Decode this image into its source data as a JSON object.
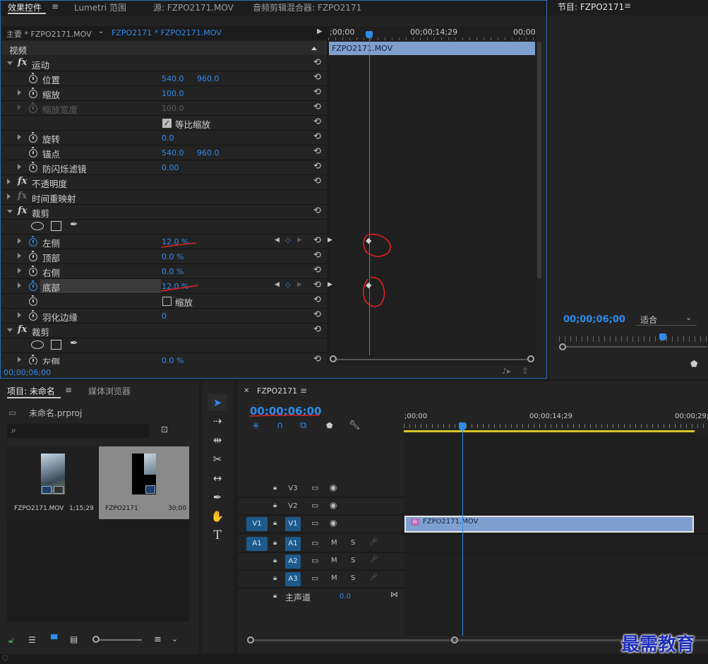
{
  "effect_controls": {
    "tabs": [
      "效果控件",
      "Lumetri 范围",
      "源: FZPO2171.MOV",
      "音频剪辑混合器: FZPO2171"
    ],
    "master_label": "主要 * FZPO2171.MOV",
    "sequence_clip_label": "FZPO2171 * FZPO2171.MOV",
    "section_video": "视频",
    "timeline_start": ";00;00",
    "timeline_mid": "00;00;14;29",
    "timeline_end": "00;00",
    "clip_name": "FZPO2171.MOV",
    "current_time": "00;00;06;00",
    "rows": {
      "motion": "运动",
      "position": {
        "label": "位置",
        "x": "540.0",
        "y": "960.0"
      },
      "scale": {
        "label": "缩放",
        "value": "100.0"
      },
      "scale_width": {
        "label": "缩放宽度",
        "value": "100.0"
      },
      "uniform_scale": {
        "label": "等比缩放"
      },
      "rotation": {
        "label": "旋转",
        "value": "0.0"
      },
      "anchor": {
        "label": "锚点",
        "x": "540.0",
        "y": "960.0"
      },
      "antiflicker": {
        "label": "防闪烁滤镜",
        "value": "0.00"
      },
      "opacity": "不透明度",
      "time_remap": "时间重映射",
      "crop1": "裁剪",
      "left": {
        "label": "左侧",
        "value": "12.0 %"
      },
      "top": {
        "label": "顶部",
        "value": "0.0 %"
      },
      "right": {
        "label": "右侧",
        "value": "0.0 %"
      },
      "bottom": {
        "label": "底部",
        "value": "12.0 %"
      },
      "zoom": {
        "label": "缩放"
      },
      "feather": {
        "label": "羽化边缘",
        "value": "0"
      },
      "crop2": "裁剪",
      "left2": {
        "label": "左侧",
        "value": "0.0 %"
      }
    }
  },
  "program": {
    "title": "节目: FZPO2171",
    "timecode": "00;00;06;00",
    "fit_label": "适合"
  },
  "project": {
    "tab_project": "项目: 未命名",
    "tab_media": "媒体浏览器",
    "file_name": "未命名.prproj",
    "search_placeholder": "",
    "items": [
      {
        "name": "FZPO2171.MOV",
        "duration": "1;15;29"
      },
      {
        "name": "FZPO2171",
        "duration": "30;00"
      }
    ]
  },
  "timeline": {
    "sequence_name": "FZPO2171",
    "timecode": "00;00;06;00",
    "ruler_start": ";00;00",
    "ruler_mid": "00;00;14;29",
    "ruler_end": "00;00;29;",
    "tracks_video": [
      "V3",
      "V2",
      "V1"
    ],
    "tracks_audio": [
      "A1",
      "A2",
      "A3"
    ],
    "source_v": "V1",
    "source_a": "A1",
    "master_label": "主声道",
    "master_value": "0.0",
    "clip_label": "FZPO2171.MOV",
    "m_label": "M",
    "s_label": "S"
  },
  "watermark": "最需教育",
  "colors": {
    "accent": "#2e8ceb",
    "clip": "#7f9fcf",
    "panel_bg": "#232323"
  }
}
